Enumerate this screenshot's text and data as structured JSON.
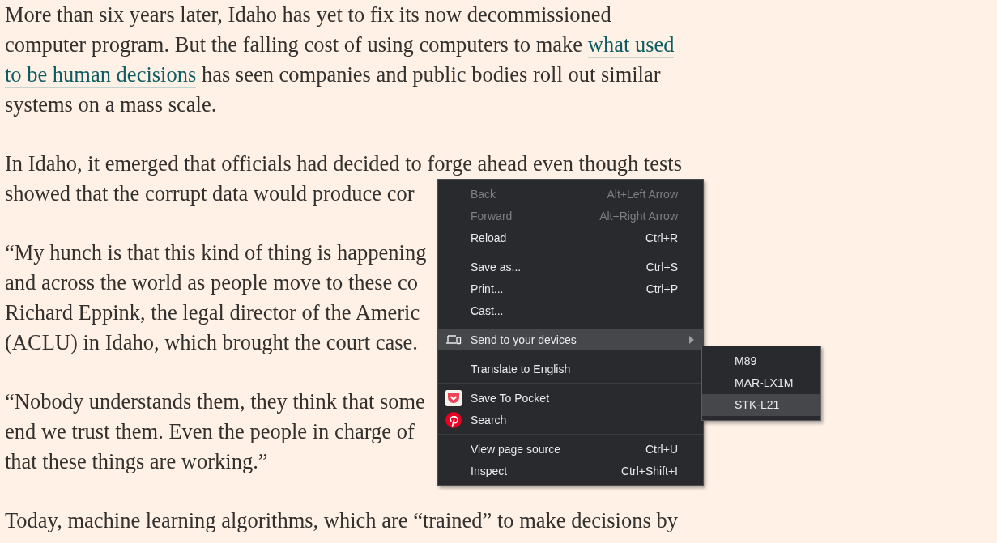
{
  "article": {
    "paragraphs": [
      {
        "lines": [
          [
            {
              "kind": "text",
              "text": "More than six years later, Idaho has yet to fix its now decommissioned"
            }
          ],
          [
            {
              "kind": "text",
              "text": "computer program. But the falling cost of using computers to make "
            },
            {
              "kind": "link",
              "text": "what used"
            }
          ],
          [
            {
              "kind": "link",
              "text": "to be human decisions"
            },
            {
              "kind": "text",
              "text": " has seen companies and public bodies roll out similar"
            }
          ],
          [
            {
              "kind": "text",
              "text": "systems on a mass scale."
            }
          ]
        ]
      },
      {
        "lines": [
          [
            {
              "kind": "text",
              "text": "In Idaho, it emerged that officials had decided to forge ahead even though tests"
            }
          ],
          [
            {
              "kind": "text",
              "text": "showed that the corrupt data would produce cor"
            }
          ]
        ]
      },
      {
        "lines": [
          [
            {
              "kind": "text",
              "text": "“My hunch is that this kind of thing is happening"
            }
          ],
          [
            {
              "kind": "text",
              "text": "and across the world as people move to these co"
            }
          ],
          [
            {
              "kind": "text",
              "text": "Richard Eppink, the legal director of the Americ"
            }
          ],
          [
            {
              "kind": "text",
              "text": "(ACLU) in Idaho, which brought the court case."
            }
          ]
        ]
      },
      {
        "lines": [
          [
            {
              "kind": "text",
              "text": "“Nobody understands them, they think that some"
            }
          ],
          [
            {
              "kind": "text",
              "text": "end we trust them. Even the people in charge of"
            }
          ],
          [
            {
              "kind": "text",
              "text": "that these things are working.”"
            }
          ]
        ]
      },
      {
        "lines": [
          [
            {
              "kind": "text",
              "text": "Today, machine learning algorithms, which are “trained” to make decisions by"
            }
          ]
        ]
      }
    ]
  },
  "context_menu": {
    "items": [
      {
        "kind": "item",
        "label": "Back",
        "shortcut": "Alt+Left Arrow",
        "disabled": true,
        "highlighted": false
      },
      {
        "kind": "item",
        "label": "Forward",
        "shortcut": "Alt+Right Arrow",
        "disabled": true,
        "highlighted": false
      },
      {
        "kind": "item",
        "label": "Reload",
        "shortcut": "Ctrl+R",
        "disabled": false,
        "highlighted": false
      },
      {
        "kind": "separator"
      },
      {
        "kind": "item",
        "label": "Save as...",
        "shortcut": "Ctrl+S",
        "disabled": false,
        "highlighted": false
      },
      {
        "kind": "item",
        "label": "Print...",
        "shortcut": "Ctrl+P",
        "disabled": false,
        "highlighted": false
      },
      {
        "kind": "item",
        "label": "Cast...",
        "disabled": false,
        "highlighted": false
      },
      {
        "kind": "separator"
      },
      {
        "kind": "devices",
        "label": "Send to your devices",
        "submenu": true,
        "disabled": false,
        "highlighted": true
      },
      {
        "kind": "separator"
      },
      {
        "kind": "item",
        "label": "Translate to English",
        "disabled": false,
        "highlighted": false
      },
      {
        "kind": "separator"
      },
      {
        "kind": "pocket",
        "label": "Save To Pocket",
        "disabled": false,
        "highlighted": false
      },
      {
        "kind": "pin",
        "label": "Search",
        "disabled": false,
        "highlighted": false
      },
      {
        "kind": "separator"
      },
      {
        "kind": "item",
        "label": "View page source",
        "shortcut": "Ctrl+U",
        "disabled": false,
        "highlighted": false
      },
      {
        "kind": "item",
        "label": "Inspect",
        "shortcut": "Ctrl+Shift+I",
        "disabled": false,
        "highlighted": false
      }
    ]
  },
  "submenu": {
    "items": [
      {
        "label": "M89",
        "selected": false
      },
      {
        "label": "MAR-LX1M",
        "selected": false
      },
      {
        "label": "STK-L21",
        "selected": true
      }
    ]
  }
}
